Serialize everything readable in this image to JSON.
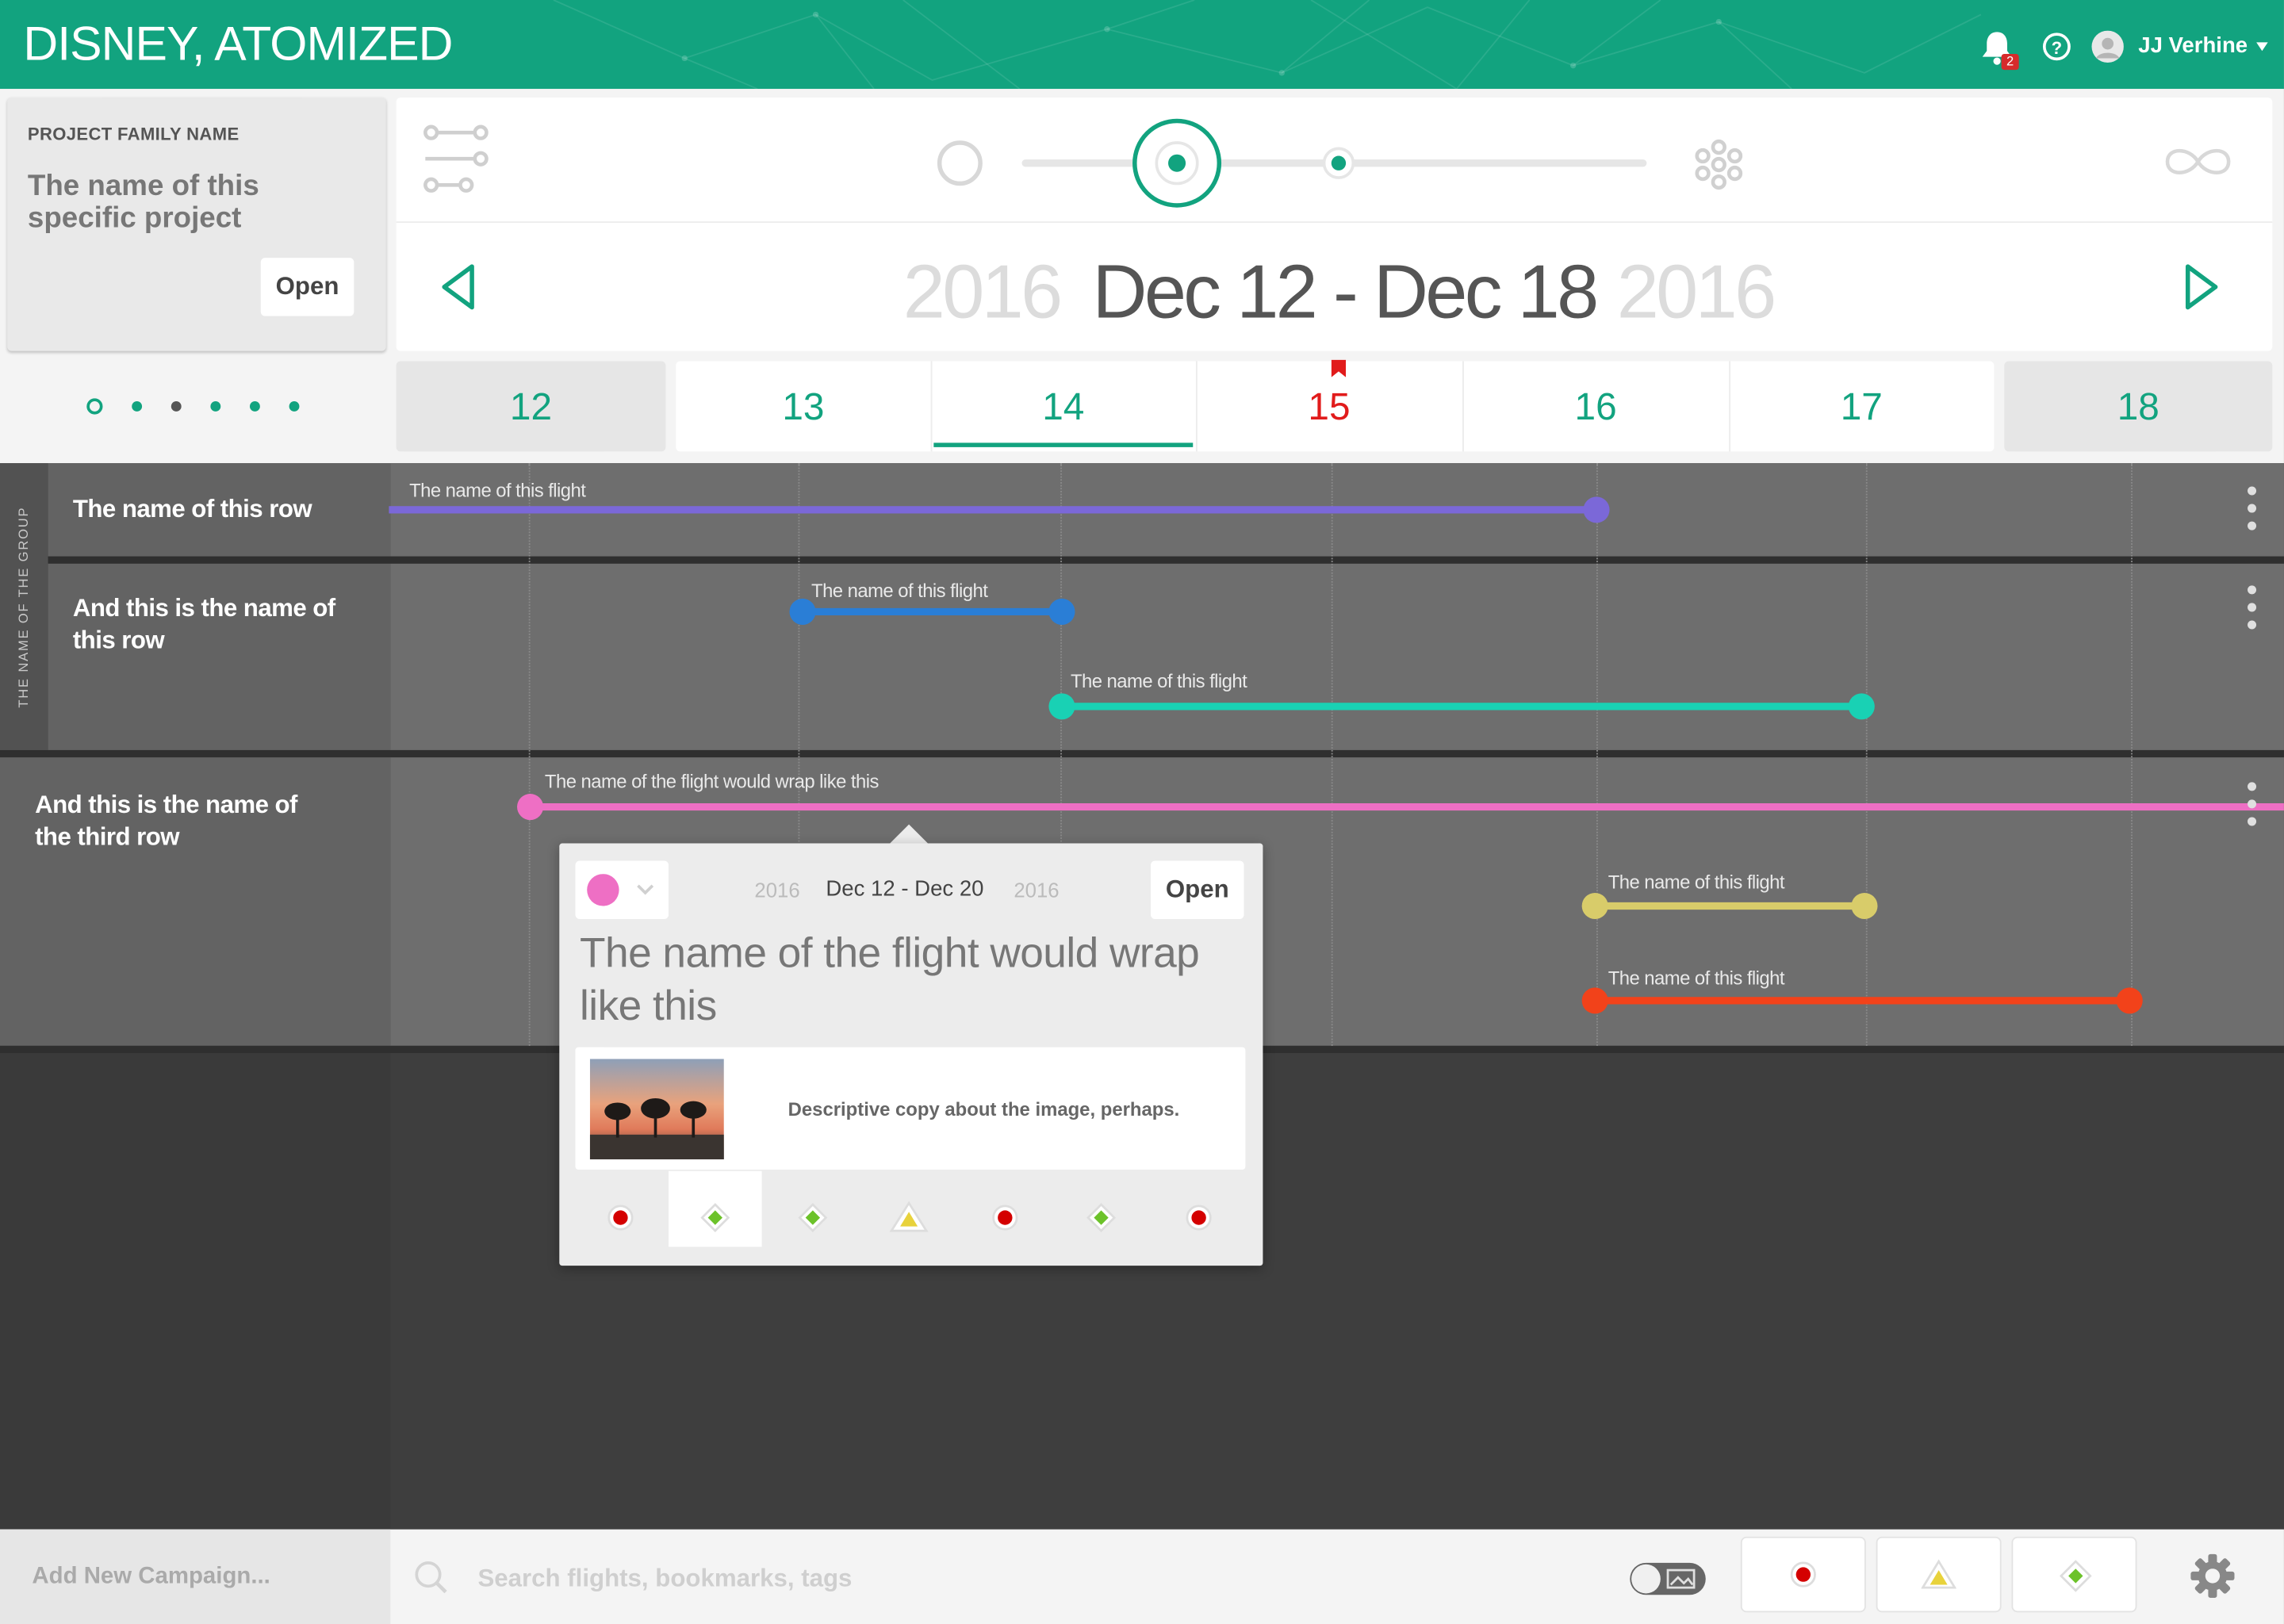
{
  "app": {
    "logo": "DISNEY, ATOMIZED"
  },
  "header": {
    "user_name": "JJ Verhine",
    "notification_count": "2",
    "brand_color": "#12a37f"
  },
  "project": {
    "family_label": "PROJECT FAMILY NAME",
    "name": "The name of this specific project",
    "open_label": "Open"
  },
  "date_range": {
    "year_left": "2016",
    "range": "Dec 12 - Dec 18",
    "year_right": "2016"
  },
  "days": [
    {
      "label": "12"
    },
    {
      "label": "13"
    },
    {
      "label": "14"
    },
    {
      "label": "15"
    },
    {
      "label": "16"
    },
    {
      "label": "17"
    },
    {
      "label": "18"
    }
  ],
  "timeline": {
    "group_name": "THE NAME OF THE GROUP",
    "rows": [
      {
        "name": "The name of this row"
      },
      {
        "name": "And this is the name of this row"
      },
      {
        "name": "And this is the name of the third row"
      }
    ],
    "flights": [
      {
        "label": "The name of this flight",
        "color": "#7b68d8"
      },
      {
        "label": "The name of this flight",
        "color": "#2a7ed6"
      },
      {
        "label": "The name of this flight",
        "color": "#19d1b4"
      },
      {
        "label": "The name of the flight would wrap like this",
        "color": "#ee6fc4"
      },
      {
        "label": "The name of this flight",
        "color": "#d8cc6a"
      },
      {
        "label": "The name of this flight",
        "color": "#f2421a"
      }
    ]
  },
  "popup": {
    "year_left": "2016",
    "dates": "Dec 12 - Dec 20",
    "year_right": "2016",
    "open_label": "Open",
    "title": "The name of the flight would wrap like this",
    "image_caption": "Descriptive copy about the image, perhaps."
  },
  "bottom": {
    "add_campaign": "Add New Campaign...",
    "search_placeholder": "Search flights, bookmarks, tags"
  }
}
